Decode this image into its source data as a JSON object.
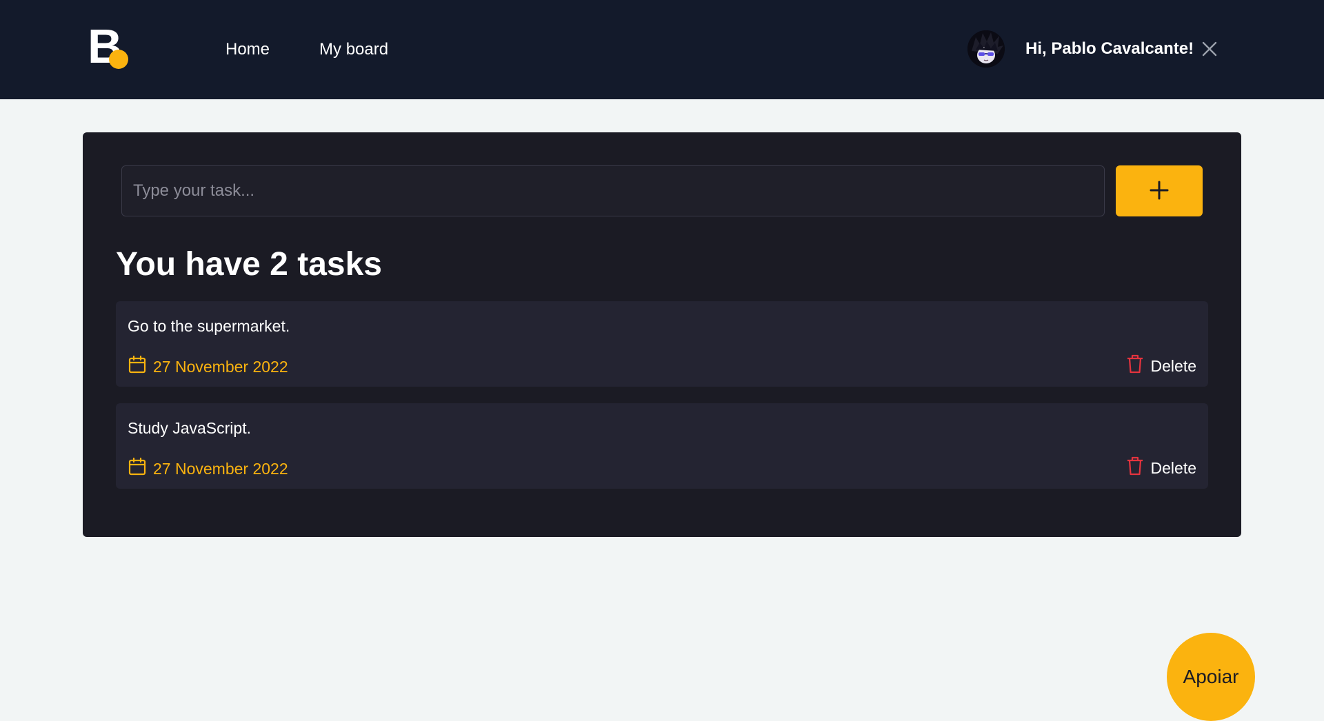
{
  "header": {
    "logo": {
      "letter": "B"
    },
    "nav": [
      {
        "label": "Home"
      },
      {
        "label": "My board"
      }
    ],
    "user": {
      "greeting": "Hi, Pablo Cavalcante!"
    }
  },
  "board": {
    "input": {
      "placeholder": "Type your task...",
      "value": ""
    },
    "add_button_icon": "plus-icon",
    "heading": "You have 2 tasks",
    "tasks": [
      {
        "text": "Go to the supermarket.",
        "date": "27 November 2022",
        "delete_label": "Delete"
      },
      {
        "text": "Study JavaScript.",
        "date": "27 November 2022",
        "delete_label": "Delete"
      }
    ]
  },
  "support_button": {
    "label": "Apoiar"
  },
  "colors": {
    "header_bg": "#131a2b",
    "card_bg": "#1b1b24",
    "task_bg": "#242432",
    "accent": "#fbb30f",
    "delete_icon": "#e5333e",
    "page_bg": "#f2f5f5"
  }
}
